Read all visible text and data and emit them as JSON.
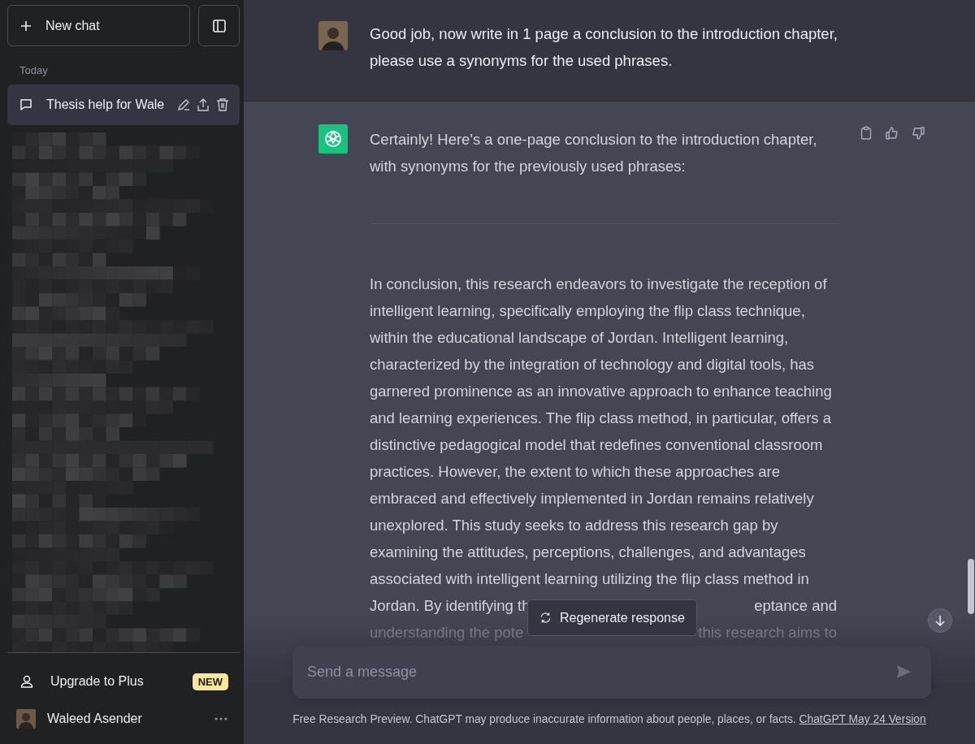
{
  "sidebar": {
    "new_chat_button": "New chat",
    "section_label": "Today",
    "conversations": [
      {
        "title": "Thesis help for Wale",
        "selected": true
      }
    ],
    "upgrade": {
      "label": "Upgrade to Plus",
      "badge": "NEW"
    },
    "user": {
      "name": "Waleed Asender"
    }
  },
  "messages": [
    {
      "kind": "user",
      "text": "Good job, now write in 1 page a conclusion to the introduction chapter, please use a synonyms for the used phrases."
    },
    {
      "kind": "assistant",
      "intro": "Certainly! Here's a one-page conclusion to the introduction chapter, with synonyms for the previously used phrases:",
      "body": "In conclusion, this research endeavors to investigate the reception of intelligent learning, specifically employing the flip class technique, within the educational landscape of Jordan. Intelligent learning, characterized by the integration of technology and digital tools, has garnered prominence as an innovative approach to enhance teaching and learning experiences. The flip class method, in particular, offers a distinctive pedagogical model that redefines conventional classroom practices. However, the extent to which these approaches are embraced and effectively implemented in Jordan remains relatively unexplored. This study seeks to address this research gap by examining the attitudes, perceptions, challenges, and advantages associated with intelligent learning utilizing the flip class method in",
      "covered_lines": [
        [
          "Jordan. By identifying th",
          "eptance and"
        ],
        [
          "understanding the pote",
          "this research aims to"
        ]
      ]
    }
  ],
  "regenerate_button": "Regenerate response",
  "composer": {
    "placeholder": "Send a message"
  },
  "footer": {
    "text": "Free Research Preview. ChatGPT may produce inaccurate information about people, places, or facts.",
    "link": "ChatGPT May 24 Version"
  }
}
